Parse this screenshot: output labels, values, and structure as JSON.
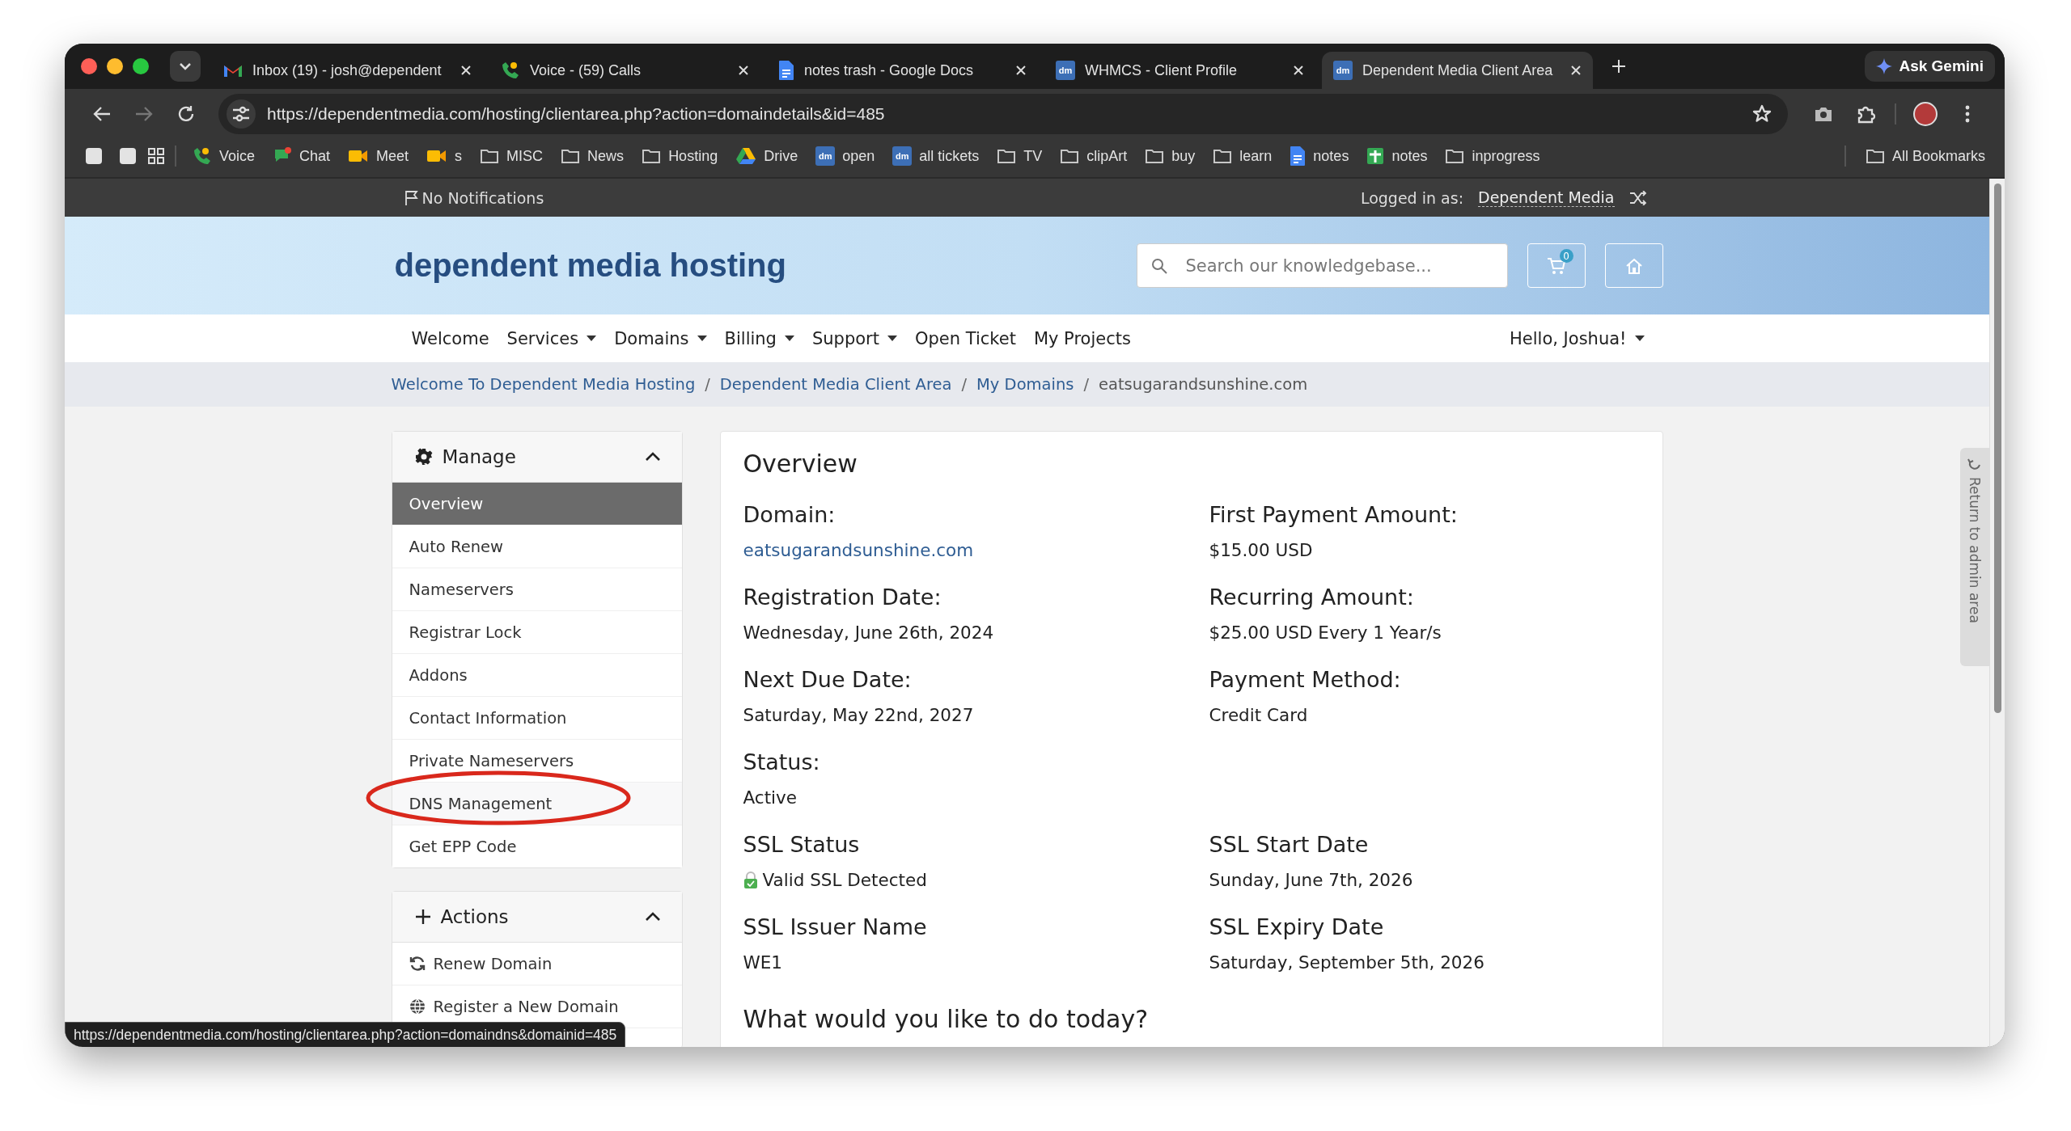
{
  "browser": {
    "tabs": [
      {
        "title": "Inbox (19) - josh@dependent",
        "kind": "gmail",
        "selected": false
      },
      {
        "title": "Voice - (59) Calls",
        "kind": "voice",
        "selected": false
      },
      {
        "title": "notes trash - Google Docs",
        "kind": "docs",
        "selected": false
      },
      {
        "title": "WHMCS - Client Profile",
        "kind": "dm",
        "icon_label": "dm",
        "selected": false
      },
      {
        "title": "Dependent Media Client Area",
        "kind": "dm",
        "icon_label": "dm",
        "selected": true
      }
    ],
    "ask_gemini": "Ask Gemini",
    "url": "https://dependentmedia.com/hosting/clientarea.php?action=domaindetails&id=485",
    "bookmarks": [
      {
        "kind": "square"
      },
      {
        "kind": "square"
      },
      {
        "kind": "grid"
      },
      {
        "kind": "divider"
      },
      {
        "label": "Voice",
        "kind": "voice"
      },
      {
        "label": "Chat",
        "kind": "chat"
      },
      {
        "label": "Meet",
        "kind": "meet"
      },
      {
        "label": "s",
        "kind": "meet"
      },
      {
        "label": "MISC",
        "kind": "folder"
      },
      {
        "label": "News",
        "kind": "folder"
      },
      {
        "label": "Hosting",
        "kind": "folder"
      },
      {
        "label": "Drive",
        "kind": "drive"
      },
      {
        "label": "open",
        "kind": "dm",
        "icon_label": "dm"
      },
      {
        "label": "all tickets",
        "kind": "dm",
        "icon_label": "dm"
      },
      {
        "label": "TV",
        "kind": "folder"
      },
      {
        "label": "clipArt",
        "kind": "folder"
      },
      {
        "label": "buy",
        "kind": "folder"
      },
      {
        "label": "learn",
        "kind": "folder"
      },
      {
        "label": "notes",
        "kind": "docs"
      },
      {
        "label": "notes",
        "kind": "sheets"
      },
      {
        "label": "inprogress",
        "kind": "folder"
      }
    ],
    "all_bookmarks": "All Bookmarks"
  },
  "site": {
    "topbar": {
      "notifications": "No Notifications",
      "logged_in_label": "Logged in as:",
      "logged_in_user": "Dependent Media"
    },
    "header": {
      "brand": "dependent media hosting",
      "search": {
        "placeholder": "Search our knowledgebase..."
      },
      "cart_count": "0"
    },
    "nav": [
      {
        "label": "Welcome",
        "dropdown": false
      },
      {
        "label": "Services",
        "dropdown": true
      },
      {
        "label": "Domains",
        "dropdown": true
      },
      {
        "label": "Billing",
        "dropdown": true
      },
      {
        "label": "Support",
        "dropdown": true
      },
      {
        "label": "Open Ticket",
        "dropdown": false
      },
      {
        "label": "My Projects",
        "dropdown": false
      }
    ],
    "user_menu": {
      "label": "Hello, Joshua!",
      "dropdown": true
    },
    "breadcrumb": {
      "separator": "/",
      "items": [
        {
          "label": "Welcome To Dependent Media Hosting",
          "link": true
        },
        {
          "label": "Dependent Media Client Area",
          "link": true
        },
        {
          "label": "My Domains",
          "link": true
        },
        {
          "label": "eatsugarandsunshine.com",
          "link": false
        }
      ]
    },
    "sidebar": [
      {
        "title": "Manage",
        "kind": "gear",
        "expanded": true,
        "items": [
          {
            "label": "Overview",
            "selected": true,
            "circled": false
          },
          {
            "label": "Auto Renew",
            "selected": false,
            "circled": false
          },
          {
            "label": "Nameservers",
            "selected": false,
            "circled": false
          },
          {
            "label": "Registrar Lock",
            "selected": false,
            "circled": false
          },
          {
            "label": "Addons",
            "selected": false,
            "circled": false
          },
          {
            "label": "Contact Information",
            "selected": false,
            "circled": false
          },
          {
            "label": "Private Nameservers",
            "selected": false,
            "circled": false
          },
          {
            "label": "DNS Management",
            "selected": false,
            "circled": true
          },
          {
            "label": "Get EPP Code",
            "selected": false,
            "circled": false
          }
        ]
      },
      {
        "title": "Actions",
        "kind": "plus",
        "expanded": true,
        "items": [
          {
            "label": "Renew Domain",
            "kind": "refresh",
            "selected": false,
            "circled": false
          },
          {
            "label": "Register a New Domain",
            "kind": "globe",
            "selected": false,
            "circled": false
          }
        ]
      }
    ],
    "overview": {
      "title": "Overview",
      "rows": [
        [
          {
            "label": "Domain:",
            "value": "eatsugarandsunshine.com",
            "kind": "link"
          },
          {
            "label": "First Payment Amount:",
            "value": "$15.00 USD",
            "kind": "text"
          }
        ],
        [
          {
            "label": "Registration Date:",
            "value": "Wednesday, June 26th, 2024",
            "kind": "text"
          },
          {
            "label": "Recurring Amount:",
            "value": "$25.00 USD Every 1 Year/s",
            "kind": "text"
          }
        ],
        [
          {
            "label": "Next Due Date:",
            "value": "Saturday, May 22nd, 2027",
            "kind": "text"
          },
          {
            "label": "Payment Method:",
            "value": "Credit Card",
            "kind": "text"
          }
        ],
        [
          {
            "label": "Status:",
            "value": "Active",
            "kind": "text"
          }
        ],
        [
          {
            "label": "SSL Status",
            "value": "Valid SSL Detected",
            "kind": "ssl"
          },
          {
            "label": "SSL Start Date",
            "value": "Sunday, June 7th, 2026",
            "kind": "text"
          }
        ],
        [
          {
            "label": "SSL Issuer Name",
            "value": "WE1",
            "kind": "text"
          },
          {
            "label": "SSL Expiry Date",
            "value": "Saturday, September 5th, 2026",
            "kind": "text"
          }
        ]
      ],
      "question": "What would you like to do today?"
    },
    "admin_tab": "Return to admin area",
    "status_url": "https://dependentmedia.com/hosting/clientarea.php?action=domaindns&domainid=485"
  }
}
